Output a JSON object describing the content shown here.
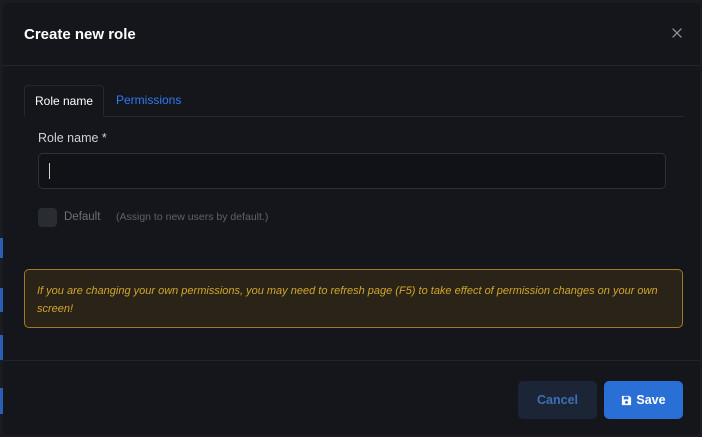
{
  "modal": {
    "title": "Create new role",
    "close_icon": "close-icon"
  },
  "tabs": [
    {
      "label": "Role name",
      "active": true
    },
    {
      "label": "Permissions",
      "active": false
    }
  ],
  "form": {
    "role_name_label": "Role name *",
    "role_name_value": "",
    "default_label": "Default",
    "default_hint": "(Assign to new users by default.)",
    "default_checked": false
  },
  "alert": {
    "text": "If you are changing your own permissions, you may need to refresh page (F5) to take effect of permission changes on your own screen!"
  },
  "footer": {
    "cancel_label": "Cancel",
    "save_label": "Save",
    "save_icon": "floppy-disk-icon"
  },
  "colors": {
    "background": "#15161b",
    "accent": "#2a6fd6",
    "warning_text": "#d3a52c",
    "warning_border": "#a27b1e"
  }
}
